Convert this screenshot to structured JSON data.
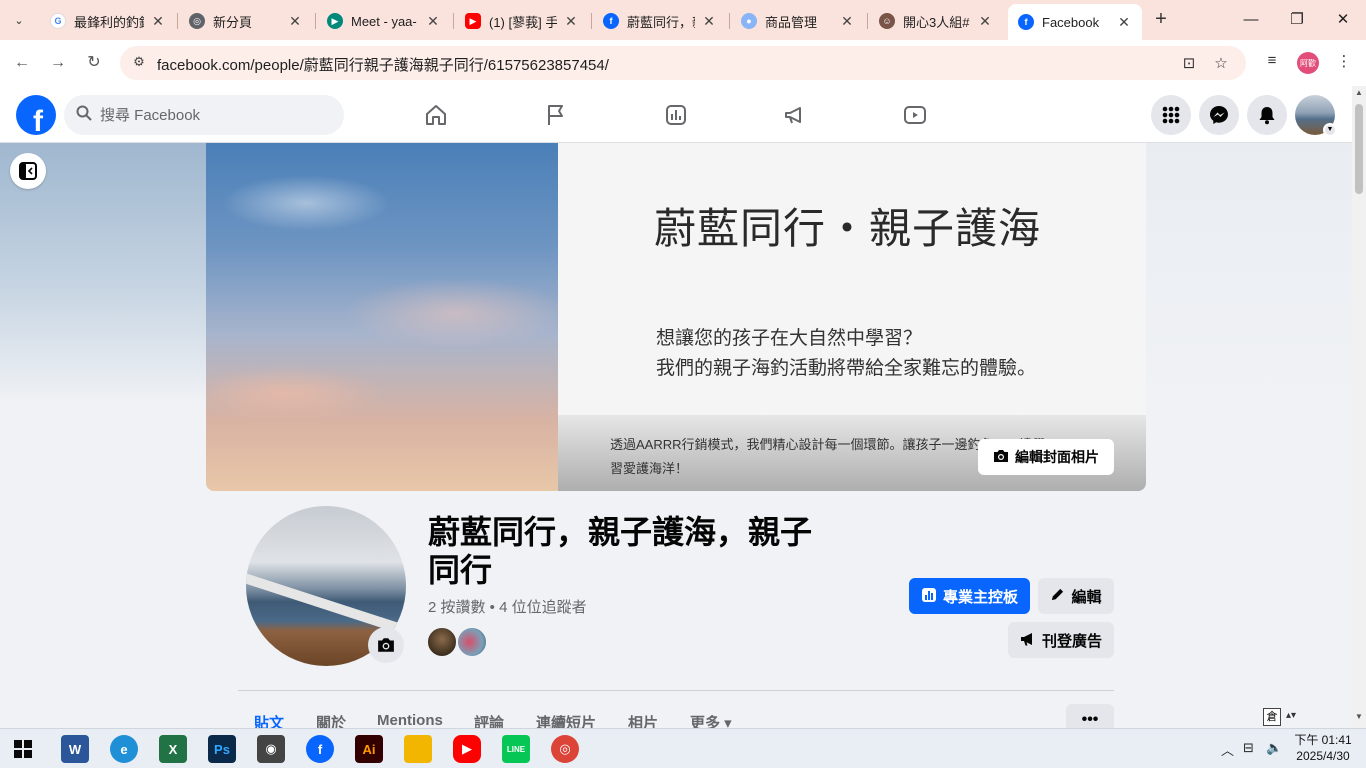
{
  "browser": {
    "tabs": [
      {
        "title": "最鋒利的釣鉤",
        "fav_color": "#4285f4",
        "fav_glyph": "G"
      },
      {
        "title": "新分頁",
        "fav_color": "#5f6368",
        "fav_glyph": "◎"
      },
      {
        "title": "Meet - yaa-",
        "fav_color": "#00897b",
        "fav_glyph": "▶"
      },
      {
        "title": "(1) [蓼莪] 手",
        "fav_color": "#ff0000",
        "fav_glyph": "▶"
      },
      {
        "title": "蔚藍同行，親",
        "fav_color": "#0866ff",
        "fav_glyph": "f"
      },
      {
        "title": "商品管理",
        "fav_color": "#8ab4f8",
        "fav_glyph": "🔒"
      },
      {
        "title": "開心3人組#",
        "fav_color": "#795548",
        "fav_glyph": "☺"
      },
      {
        "title": "Facebook",
        "fav_color": "#0866ff",
        "fav_glyph": "f"
      }
    ],
    "url": "facebook.com/people/蔚藍同行親子護海親子同行/61575623857454/",
    "profile_label": "阿歡"
  },
  "fb": {
    "search_placeholder": "搜尋 Facebook",
    "brand_color": "#0866ff"
  },
  "cover": {
    "headline": "蔚藍同行・親子護海",
    "line1": "想讓您的孩子在大自然中學習？",
    "line2": "我們的親子海釣活動將帶給全家難忘的體驗。",
    "small1": "透過AARRR行銷模式，我們精心設計每一個環節。讓孩子一邊釣魚，一邊學",
    "small2": "習愛護海洋！",
    "edit_label": "編輯封面相片"
  },
  "profile": {
    "name": "蔚藍同行，親子護海，親子同行",
    "stats": "2 按讚數 • 4 位位追蹤者",
    "dashboard_label": "專業主控板",
    "edit_label": "編輯",
    "advertise_label": "刊登廣告",
    "tabs": [
      "貼文",
      "關於",
      "Mentions",
      "評論",
      "連續短片",
      "相片",
      "更多 ▾"
    ],
    "more_label": "•••"
  },
  "ime": {
    "label": "倉"
  },
  "taskbar": {
    "apps": [
      {
        "name": "word",
        "glyph": "W",
        "color": "#2b579a"
      },
      {
        "name": "edge",
        "glyph": "e",
        "color": "#1f8fd6"
      },
      {
        "name": "excel",
        "glyph": "X",
        "color": "#217346"
      },
      {
        "name": "photoshop",
        "glyph": "Ps",
        "color": "#0b2a4a"
      },
      {
        "name": "camera",
        "glyph": "◉",
        "color": "#444444"
      },
      {
        "name": "facebook",
        "glyph": "f",
        "color": "#0866ff"
      },
      {
        "name": "illustrator",
        "glyph": "Ai",
        "color": "#330000"
      },
      {
        "name": "explorer",
        "glyph": "▬",
        "color": "#f3b600"
      },
      {
        "name": "youtube",
        "glyph": "▶",
        "color": "#ff0000"
      },
      {
        "name": "line",
        "glyph": "LINE",
        "color": "#06c755"
      },
      {
        "name": "chrome",
        "glyph": "◎",
        "color": "#db4437"
      }
    ],
    "time": "下午 01:41",
    "date": "2025/4/30"
  }
}
